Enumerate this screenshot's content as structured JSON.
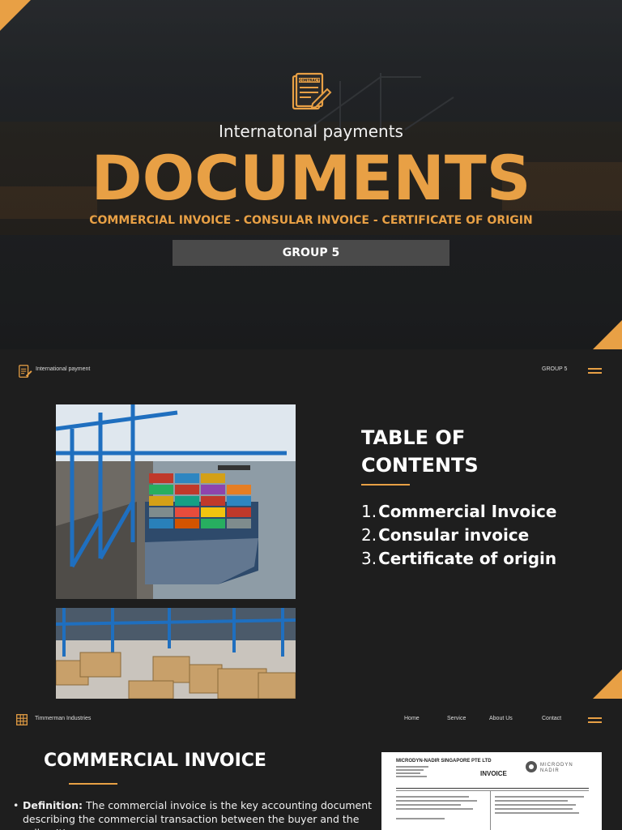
{
  "colors": {
    "accent": "#e8a045",
    "background": "#1e1e1e",
    "group_box": "#4a4a4a"
  },
  "slide1": {
    "icon": "contract-document-icon",
    "icon_text": "CONTRACT",
    "subtitle": "Internatonal payments",
    "title": "DOCUMENTS",
    "documents_line": "COMMERCIAL INVOICE - CONSULAR INVOICE - CERTIFICATE OF ORIGIN",
    "group": "GROUP 5"
  },
  "slide2": {
    "brand": "International payment",
    "group": "GROUP 5",
    "menu_icon": "hamburger-menu-icon",
    "toc_title_line1": "TABLE OF",
    "toc_title_line2": "CONTENTS",
    "toc_items": [
      {
        "num": "1.",
        "label": "Commercial Invoice"
      },
      {
        "num": "2.",
        "label": "Consular invoice"
      },
      {
        "num": "3.",
        "label": "Certificate of origin"
      }
    ]
  },
  "slide3": {
    "brand": "Timmerman Industries",
    "nav": [
      "Home",
      "Service",
      "About Us",
      "Contact"
    ],
    "title": "COMMERCIAL INVOICE",
    "definition_label": "Definition:",
    "definition_text": " The commercial invoice is the key accounting document describing the commercial transaction between the buyer and the seller. It's",
    "invoice": {
      "company": "MICRODYN-NADIR SINGAPORE PTE LTD",
      "heading": "INVOICE",
      "brand_line1": "MICRODYN",
      "brand_line2": "NADIR"
    }
  }
}
